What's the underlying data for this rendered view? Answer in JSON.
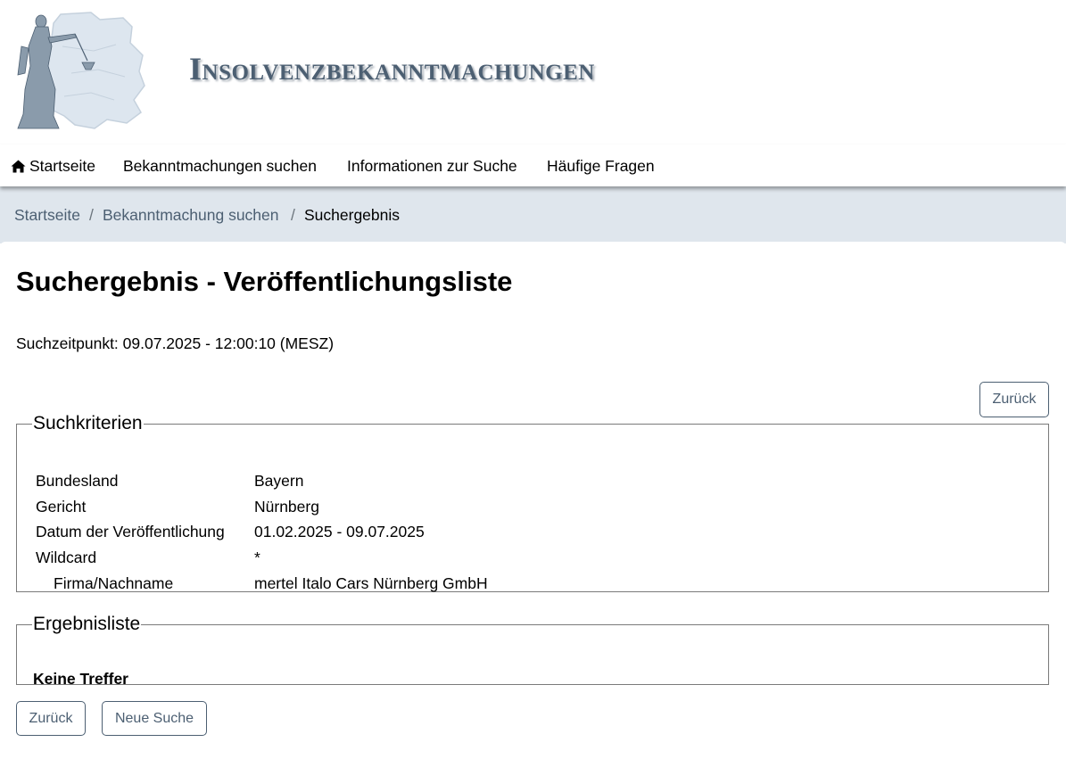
{
  "site": {
    "title": "Insolvenzbekanntmachungen"
  },
  "nav": {
    "home": "Startseite",
    "search": "Bekanntmachungen suchen",
    "info": "Informationen zur Suche",
    "faq": "Häufige Fragen"
  },
  "breadcrumb": {
    "items": [
      "Startseite",
      "Bekanntmachung suchen",
      "Suchergebnis"
    ],
    "separator": "/"
  },
  "page": {
    "title": "Suchergebnis - Veröffentlichungsliste",
    "timestamp": "Suchzeitpunkt: 09.07.2025 - 12:00:10 (MESZ)"
  },
  "buttons": {
    "back": "Zurück",
    "new_search": "Neue Suche"
  },
  "criteria": {
    "legend": "Suchkriterien",
    "rows": [
      {
        "label": "Bundesland",
        "value": "Bayern"
      },
      {
        "label": "Gericht",
        "value": "Nürnberg"
      },
      {
        "label": "Datum der Veröffentlichung",
        "value": "01.02.2025 - 09.07.2025"
      },
      {
        "label": "Wildcard",
        "value": "*"
      },
      {
        "label": "Firma/Nachname",
        "value": "mertel Italo Cars Nürnberg GmbH"
      }
    ]
  },
  "results": {
    "legend": "Ergebnisliste",
    "empty_text": "Keine Treffer"
  },
  "colors": {
    "accent": "#4c5f72",
    "breadcrumb_bg": "#dfe6ed",
    "map": "#dde6ef",
    "statue": "#8a9bab"
  },
  "icons": {
    "home": "home-icon",
    "logo": "justitia-germany-map-logo"
  }
}
